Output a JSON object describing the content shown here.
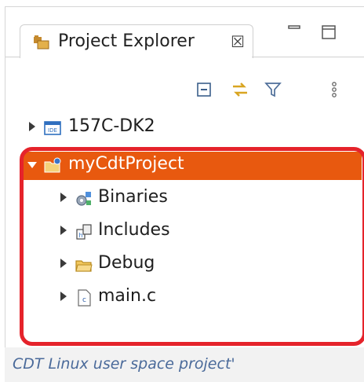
{
  "view": {
    "tab_title": "Project Explorer",
    "close_glyph": "☒"
  },
  "tree": [
    {
      "label": "157C-DK2",
      "icon": "ide-project-icon",
      "expanded": false,
      "selected": false
    },
    {
      "label": "myCdtProject",
      "icon": "c-project-folder-icon",
      "expanded": true,
      "selected": true
    },
    {
      "label": "Binaries",
      "icon": "binaries-icon",
      "expanded": false,
      "selected": false
    },
    {
      "label": "Includes",
      "icon": "includes-icon",
      "expanded": false,
      "selected": false
    },
    {
      "label": "Debug",
      "icon": "folder-icon",
      "expanded": false,
      "selected": false
    },
    {
      "label": "main.c",
      "icon": "c-file-icon",
      "expanded": false,
      "selected": false
    }
  ],
  "caption": "CDT Linux user space project'",
  "colors": {
    "selection": "#e8590f",
    "highlight": "#e5232b",
    "caption": "#4a6a9a"
  }
}
